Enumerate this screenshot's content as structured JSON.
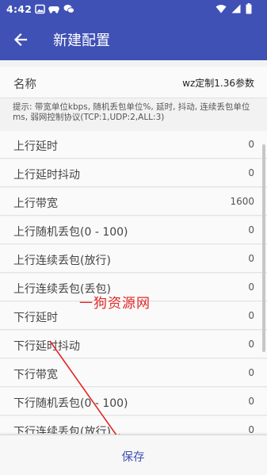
{
  "status_bar": {
    "time": "4:42",
    "icons": [
      "image-icon",
      "game-controller-icon",
      "wechat-icon",
      "wifi-icon",
      "signal-icon",
      "battery-icon"
    ]
  },
  "app_bar": {
    "title": "新建配置",
    "back_icon": "back-arrow-icon",
    "color": "#3f51b5"
  },
  "name_field": {
    "label": "名称",
    "value": "wz定制1.36参数"
  },
  "hint": "提示: 带宽单位kbps, 随机丢包单位%, 延时, 抖动, 连续丢包单位ms, 弱网控制协议(TCP:1,UDP:2,ALL:3)",
  "params": [
    {
      "label": "上行延时",
      "value": "0"
    },
    {
      "label": "上行延时抖动",
      "value": "0"
    },
    {
      "label": "上行带宽",
      "value": "1600"
    },
    {
      "label": "上行随机丢包(0 - 100)",
      "value": "0"
    },
    {
      "label": "上行连续丢包(放行)",
      "value": "0"
    },
    {
      "label": "上行连续丢包(丢包)",
      "value": "0"
    },
    {
      "label": "下行延时",
      "value": "0"
    },
    {
      "label": "下行延时抖动",
      "value": "0"
    },
    {
      "label": "下行带宽",
      "value": "0"
    },
    {
      "label": "下行随机丢包(0 - 100)",
      "value": "0"
    },
    {
      "label": "下行连续丢包(放行)",
      "value": "0"
    }
  ],
  "watermark": "一狗资源网",
  "save_button": {
    "label": "保存"
  },
  "colors": {
    "accent": "#3f51b5",
    "watermark": "#e32626"
  }
}
